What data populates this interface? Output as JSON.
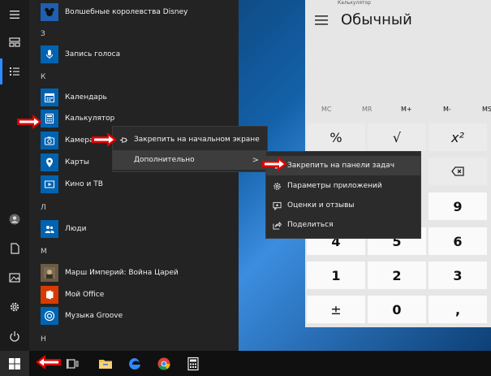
{
  "start": {
    "sections": {
      "z": "З",
      "k": "К",
      "l": "Л",
      "m": "М",
      "n": "Н"
    },
    "apps": {
      "disney": "Волшебные королевства Disney",
      "voice": "Запись голоса",
      "calendar": "Календарь",
      "calculator": "Калькулятор",
      "camera": "Камера",
      "maps": "Карты",
      "movies": "Кино и ТВ",
      "people": "Люди",
      "march": "Марш Империй: Война Царей",
      "office": "Мой Office",
      "groove": "Музыка Groove"
    }
  },
  "menu1": {
    "pin_start": "Закрепить на начальном экране",
    "more": "Дополнительно",
    "more_chevron": ">"
  },
  "menu2": {
    "pin_taskbar": "Закрепить на панели задач",
    "app_settings": "Параметры приложений",
    "rate": "Оценки и отзывы",
    "share": "Поделиться"
  },
  "calculator": {
    "window_title": "Калькулятор",
    "mode": "Обычный",
    "memory": [
      "MC",
      "MR",
      "M+",
      "M-",
      "MS"
    ],
    "keys": {
      "percent": "%",
      "sqrt": "√",
      "square": "x²",
      "nine": "9",
      "four": "4",
      "five": "5",
      "six": "6",
      "one": "1",
      "two": "2",
      "three": "3",
      "plusminus": "±",
      "zero": "0",
      "comma": ","
    }
  },
  "colors": {
    "accent": "#2d8cff",
    "arrow": "#e00000"
  }
}
